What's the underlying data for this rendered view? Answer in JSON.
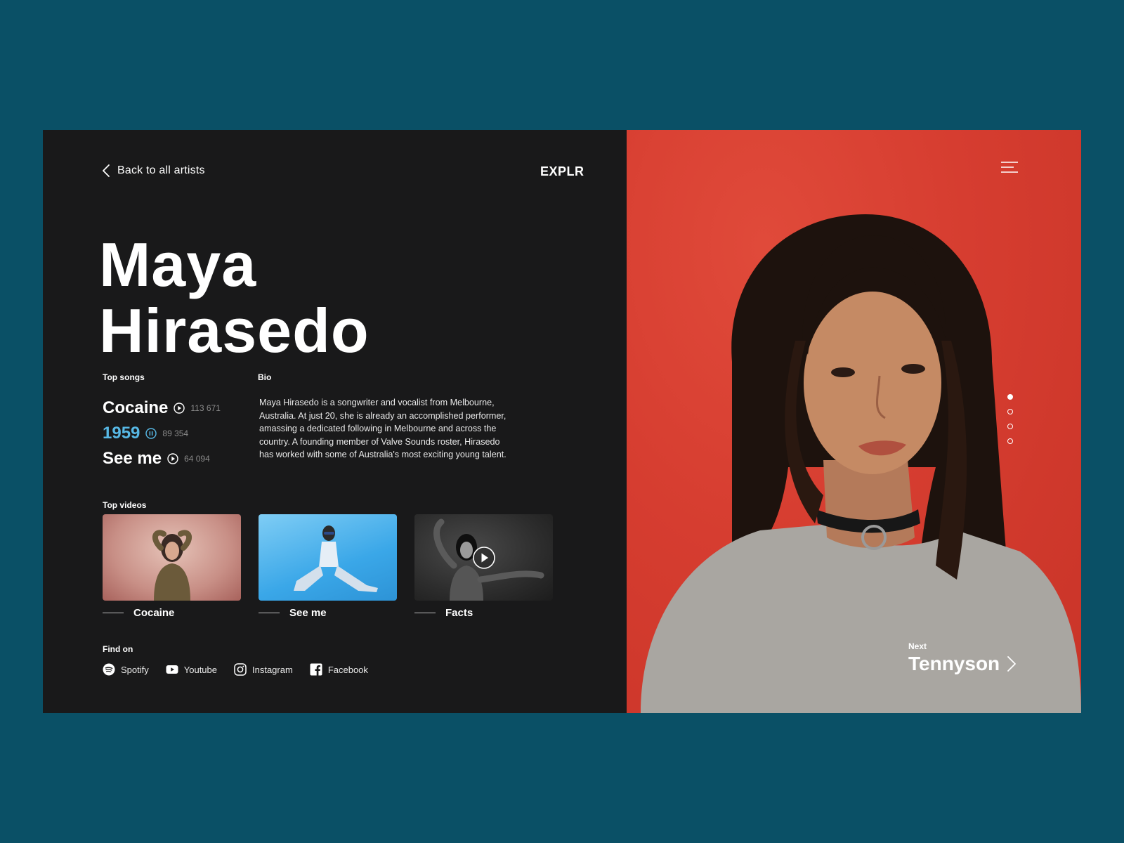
{
  "header": {
    "back_label": "Back to all artists",
    "brand": "EXPLR"
  },
  "artist": {
    "first_name": "Maya",
    "last_name": "Hirasedo"
  },
  "top_songs": {
    "label": "Top songs",
    "items": [
      {
        "title": "Cocaine",
        "plays": "113 671",
        "state": "play"
      },
      {
        "title": "1959",
        "plays": "89 354",
        "state": "pause"
      },
      {
        "title": "See me",
        "plays": "64 094",
        "state": "play"
      }
    ]
  },
  "bio": {
    "label": "Bio",
    "text": "Maya Hirasedo is a songwriter and vocalist from Melbourne, Australia. At just 20, she is already an accomplished performer, amassing a dedicated following in Melbourne and across the country. A founding member of Valve Sounds roster, Hirasedo has worked with some of Australia's most exciting young talent."
  },
  "top_videos": {
    "label": "Top videos",
    "items": [
      {
        "title": "Cocaine"
      },
      {
        "title": "See me"
      },
      {
        "title": "Facts"
      }
    ]
  },
  "find_on": {
    "label": "Find on",
    "items": [
      {
        "name": "Spotify",
        "icon": "spotify-icon"
      },
      {
        "name": "Youtube",
        "icon": "youtube-icon"
      },
      {
        "name": "Instagram",
        "icon": "instagram-icon"
      },
      {
        "name": "Facebook",
        "icon": "facebook-icon"
      }
    ]
  },
  "next_artist": {
    "label": "Next",
    "name": "Tennyson"
  },
  "pagination": {
    "count": 4,
    "active": 1
  },
  "colors": {
    "background": "#0a5066",
    "panel": "#19191a",
    "accent": "#57b8e5",
    "photo_bg": "#d63d30"
  }
}
